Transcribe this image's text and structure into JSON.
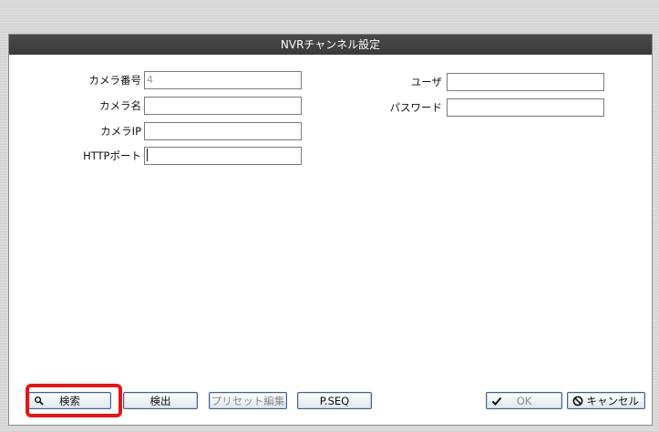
{
  "dialog": {
    "title": "NVRチャンネル設定"
  },
  "fields": {
    "camera_number": {
      "label": "カメラ番号",
      "value": "4"
    },
    "camera_name": {
      "label": "カメラ名",
      "value": ""
    },
    "camera_ip": {
      "label": "カメラIP",
      "value": ""
    },
    "http_port": {
      "label": "HTTPポート",
      "value": ""
    },
    "user": {
      "label": "ユーザ",
      "value": ""
    },
    "password": {
      "label": "パスワード",
      "value": ""
    }
  },
  "buttons": {
    "search": "検索",
    "detect": "検出",
    "preset_edit": "プリセット編集",
    "pseq": "P.SEQ",
    "ok": "OK",
    "cancel": "キャンセル"
  },
  "colors": {
    "titlebar": "#3a3a3a",
    "highlight": "#e01818",
    "button_border": "#3f5f8f"
  },
  "icons": {
    "search": "magnifier-icon",
    "ok": "checkmark-icon",
    "cancel": "no-entry-icon"
  }
}
